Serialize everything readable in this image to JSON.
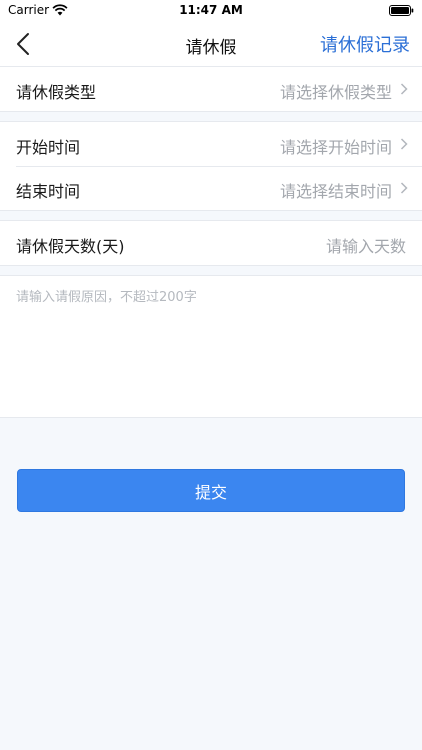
{
  "status_bar": {
    "carrier": "Carrier",
    "time": "11:47 AM",
    "icons": [
      "wifi-icon",
      "battery-icon"
    ]
  },
  "nav": {
    "back_icon": "chevron-left-icon",
    "title": "请休假",
    "right_action": "请休假记录",
    "accent_color": "#2b6fd6"
  },
  "form": {
    "leave_type": {
      "label": "请休假类型",
      "placeholder": "请选择休假类型"
    },
    "start_time": {
      "label": "开始时间",
      "placeholder": "请选择开始时间"
    },
    "end_time": {
      "label": "结束时间",
      "placeholder": "请选择结束时间"
    },
    "days": {
      "label": "请休假天数(天)",
      "placeholder": "请输入天数"
    },
    "reason": {
      "placeholder": "请输入请假原因，不超过200字",
      "value": ""
    }
  },
  "submit": {
    "label": "提交",
    "color": "#3b86f0"
  }
}
